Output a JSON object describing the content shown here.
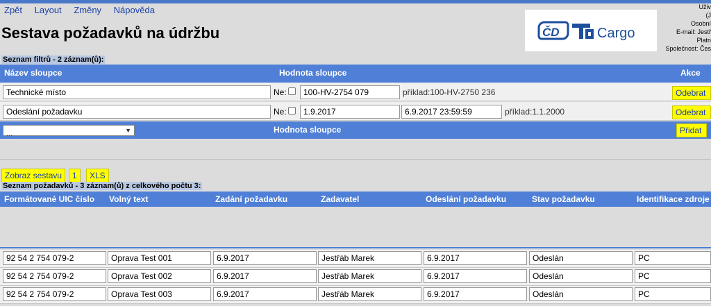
{
  "menu": {
    "items": [
      "Zpět",
      "Layout",
      "Změny",
      "Nápověda"
    ]
  },
  "page_title": "Sestava požadavků na údržbu",
  "logo": {
    "left_text": "ČD",
    "right_text": "Cargo"
  },
  "user": {
    "lines": [
      "Uživ",
      "(J",
      "Osobní",
      "E-mail: Jestř",
      "Platn",
      "Společnost: Čes"
    ]
  },
  "filters": {
    "label": "Seznam filtrů - 2 záznam(ů):",
    "header": {
      "col_name": "Název sloupce",
      "col_value": "Hodnota sloupce",
      "col_action": "Akce"
    },
    "rows": [
      {
        "name": "Technické místo",
        "ne_label": "Ne:",
        "value": "100-HV-2754 079",
        "example": "příklad:100-HV-2750 236",
        "action": "Odebrat"
      },
      {
        "name": "Odeslání požadavku",
        "ne_label": "Ne:",
        "value_from": "1.9.2017",
        "value_to": "6.9.2017 23:59:59",
        "example": "příklad:1.1.2000",
        "action": "Odebrat"
      }
    ],
    "add_row": {
      "select_value": "...",
      "value_label": "Hodnota sloupce",
      "add_button": "Přidat"
    }
  },
  "actions": {
    "show_report": "Zobraz sestavu",
    "page": "1",
    "xls": "XLS"
  },
  "requests": {
    "label": "Seznam požadavků - 3 záznam(ů) z celkového počtu 3:",
    "columns": [
      "Formátované UIC číslo",
      "Volný text",
      "Zadání požadavku",
      "Zadavatel",
      "Odeslání požadavku",
      "Stav požadavku",
      "Identifikace zdroje"
    ],
    "rows": [
      [
        "92 54 2 754 079-2",
        "Oprava Test 001",
        "6.9.2017",
        "Jestřáb Marek",
        "6.9.2017",
        "Odeslán",
        "PC"
      ],
      [
        "92 54 2 754 079-2",
        "Oprava Test 002",
        "6.9.2017",
        "Jestřáb Marek",
        "6.9.2017",
        "Odeslán",
        "PC"
      ],
      [
        "92 54 2 754 079-2",
        "Oprava Test 003",
        "6.9.2017",
        "Jestřáb Marek",
        "6.9.2017",
        "Odeslán",
        "PC"
      ]
    ]
  },
  "colors": {
    "accent": "#4f7fd6",
    "button": "#ffff00",
    "link": "#1a3fa8"
  }
}
